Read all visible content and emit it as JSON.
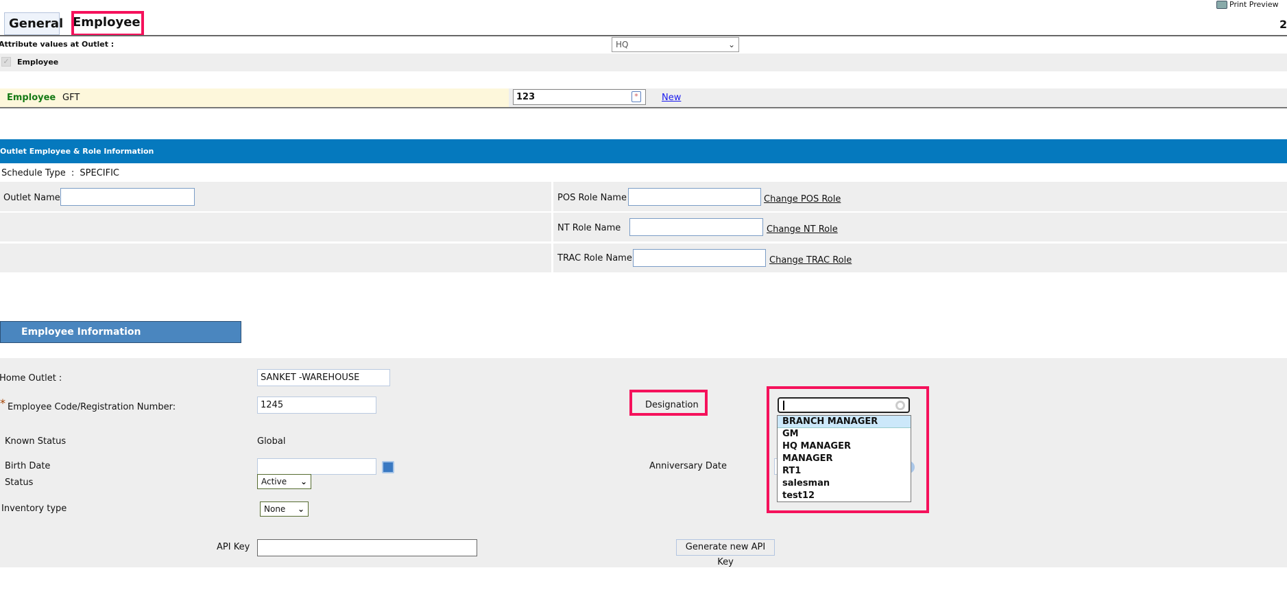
{
  "tabs": [
    {
      "label": "General"
    },
    {
      "label": "Employee"
    }
  ],
  "print_preview": "Print Preview",
  "page_marker": "2",
  "attribute": {
    "label": "Attribute values at Outlet :",
    "outlet": "HQ"
  },
  "employee_checkbox": {
    "label": "Employee",
    "checked": true
  },
  "employee_bar": {
    "label": "Employee",
    "code": "GFT",
    "value": "123",
    "new_link": "New"
  },
  "role_section": {
    "title": "Outlet Employee & Role Information",
    "schedule_label": "Schedule Type",
    "schedule_sep": ":",
    "schedule_value": "SPECIFIC",
    "outlet_name_label": "Outlet Name",
    "pos_label": "POS Role Name",
    "pos_link": "Change POS Role",
    "nt_label": "NT Role Name",
    "nt_link": "Change NT Role",
    "trac_label": "TRAC Role Name",
    "trac_link": "Change TRAC Role"
  },
  "info": {
    "title": "Employee Information",
    "home_outlet_label": "Home Outlet :",
    "home_outlet_value": "SANKET -WAREHOUSE",
    "required_mark": "*",
    "code_label": "Employee Code/Registration Number:",
    "code_value": "1245",
    "known_status_label": "Known Status",
    "known_status_value": "Global",
    "birth_label": "Birth Date",
    "status_label": "Status",
    "status_value": "Active",
    "inventory_label": "Inventory type",
    "inventory_value": "None",
    "api_label": "API Key",
    "generate_button": "Generate new API Key",
    "designation_label": "Designation",
    "anniversary_label": "Anniversary Date",
    "designation_options": [
      "BRANCH MANAGER",
      "GM",
      "HQ MANAGER",
      "MANAGER",
      "RT1",
      "salesman",
      "test12"
    ]
  },
  "colors": {
    "blue_bar": "#0579be",
    "info_tab": "#4a86bf",
    "highlight": "#f5115b"
  }
}
